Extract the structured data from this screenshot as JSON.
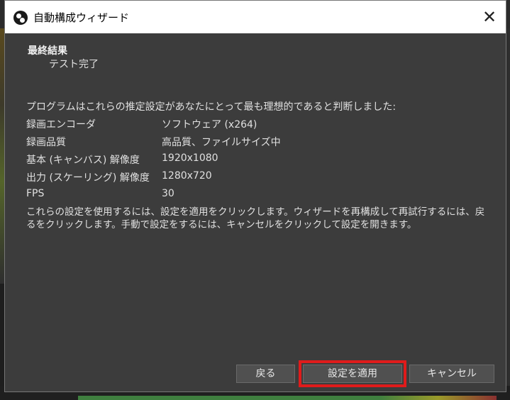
{
  "window": {
    "title": "自動構成ウィザード",
    "close_glyph": "✕"
  },
  "result": {
    "heading": "最終結果",
    "status": "テスト完了",
    "intro": "プログラムはこれらの推定設定があなたにとって最も理想的であると判断しました:",
    "settings": [
      {
        "label": "録画エンコーダ",
        "value": "ソフトウェア (x264)"
      },
      {
        "label": "録画品質",
        "value": "高品質、ファイルサイズ中"
      },
      {
        "label": "基本 (キャンバス) 解像度",
        "value": "1920x1080"
      },
      {
        "label": "出力 (スケーリング) 解像度",
        "value": "1280x720"
      },
      {
        "label": "FPS",
        "value": "30"
      }
    ],
    "description": "これらの設定を使用するには、設定を適用をクリックします。ウィザードを再構成して再試行するには、戻るをクリックします。手動で設定をするには、キャンセルをクリックして設定を開きます。"
  },
  "buttons": {
    "back": "戻る",
    "apply": "設定を適用",
    "cancel": "キャンセル"
  },
  "colors": {
    "dialog_bg": "#3c3c3c",
    "titlebar_bg": "#ffffff",
    "highlight": "#e01b1b",
    "button_bg": "#505050"
  }
}
